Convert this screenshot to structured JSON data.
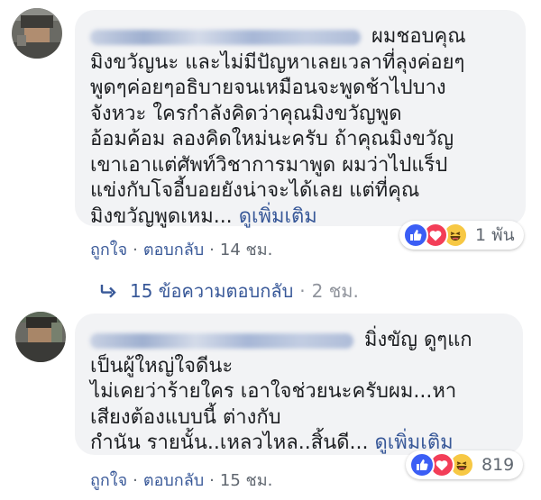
{
  "comments": [
    {
      "lines": [
        "ผมชอบคุณ",
        "มิงขวัญนะ และไม่มีปัญหาเลยเวลาที่ลุงค่อยๆ",
        "พูดๆค่อยๆอธิบายจนเหมือนจะพูดช้าไปบาง",
        "จังหวะ ใครกำลังคิดว่าคุณมิงขวัญพูด",
        "อ้อมค้อม ลองคิดใหม่นะครับ ถ้าคุณมิงขวัญ",
        "เขาเอาแต่ศัพท์วิชาการมาพูด ผมว่าไปแร็ป",
        "แข่งกับโจอี้บอยยังน่าจะได้เลย แต่ที่คุณ"
      ],
      "last_line_text": "มิงขวัญพูดเหม...",
      "see_more": "ดูเพิ่มเติม",
      "reaction_count": "1 พัน",
      "like_label": "ถูกใจ",
      "reply_label": "ตอบกลับ",
      "time": "14 ชม."
    },
    {
      "lines": [
        "มิ่งขัญ ดูๆแก",
        "เป็นผู้ใหญ่ใจดีนะ",
        "ไม่เคยว่าร้ายใคร เอาใจช่วยนะครับผม...หา",
        "เสียงต้องแบบนี้ ต่างกับ"
      ],
      "last_line_text": "กำนัน รายนั้น..เหลวไหล..สิ้นดี...",
      "see_more": "ดูเพิ่มเติม",
      "reaction_count": "819",
      "like_label": "ถูกใจ",
      "reply_label": "ตอบกลับ",
      "time": "15 ชม."
    }
  ],
  "replies": {
    "label": "15 ข้อความตอบกลับ",
    "time": "2 ชม."
  },
  "separator": "·",
  "colors": {
    "link": "#385898",
    "bubble": "#f2f3f5",
    "text": "#1c1e21",
    "meta": "#606770",
    "like": "#3b5ef5",
    "love": "#f33e58",
    "haha": "#f7c844"
  },
  "icons": [
    "avatar-blurred",
    "like-reaction-icon",
    "love-reaction-icon",
    "haha-reaction-icon",
    "reply-arrow-icon"
  ]
}
